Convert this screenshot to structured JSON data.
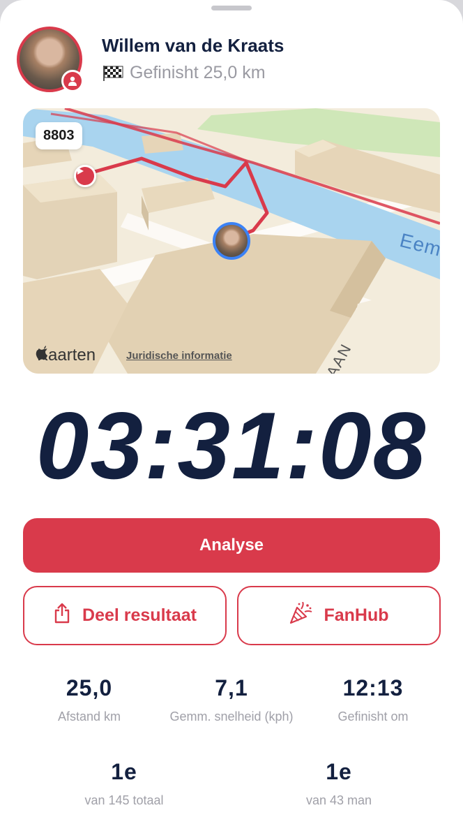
{
  "athlete": {
    "name": "Willem van de Kraats",
    "status": "Gefinisht 25,0 km"
  },
  "map": {
    "bib": "8803",
    "brand": "Kaarten",
    "legal": "Juridische informatie",
    "water_label": "Eem",
    "street_label": "AAN"
  },
  "timer": "03:31:08",
  "actions": {
    "analyse": "Analyse",
    "share": "Deel resultaat",
    "fanhub": "FanHub"
  },
  "stats": [
    {
      "value": "25,0",
      "label": "Afstand km"
    },
    {
      "value": "7,1",
      "label": "Gemm. snelheid (kph)"
    },
    {
      "value": "12:13",
      "label": "Gefinisht om"
    }
  ],
  "rankings": [
    {
      "value": "1e",
      "label": "van 145 totaal"
    },
    {
      "value": "1e",
      "label": "van 43 man"
    }
  ],
  "colors": {
    "accent": "#d93a4b",
    "navy": "#13203f",
    "muted": "#a0a0a8",
    "runner_ring": "#3b82f6"
  }
}
